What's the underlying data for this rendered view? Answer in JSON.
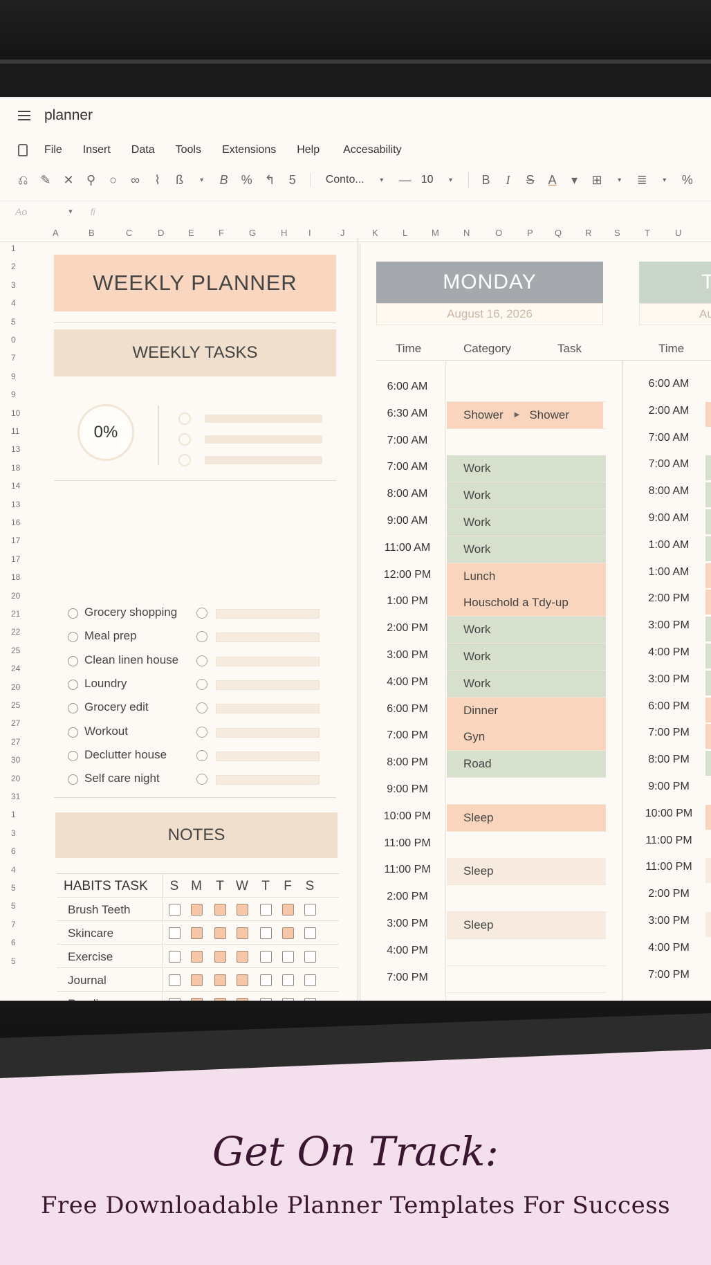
{
  "app": {
    "doc_title": "planner",
    "menu": [
      "File",
      "Insert",
      "Data",
      "Tools",
      "Extensions",
      "Help",
      "Accesability"
    ],
    "toolbar": {
      "icons": [
        "undo-icon",
        "paint-format-icon",
        "clear-icon",
        "highlight-icon",
        "search-icon",
        "zoom-icon",
        "link-icon",
        "bold-b-icon"
      ],
      "bold": "B",
      "percent": "%",
      "currency": "5",
      "font": "Conto...",
      "minus": "—",
      "size": "10",
      "bold2": "B",
      "italic": "I",
      "strike": "S",
      "text_color": "A"
    },
    "formula": {
      "cell_ref": "Ao",
      "fx": "fi"
    },
    "columns": [
      "A",
      "B",
      "C",
      "D",
      "E",
      "F",
      "G",
      "H",
      "I",
      "J",
      "K",
      "L",
      "M",
      "N",
      "O",
      "P",
      "Q",
      "R",
      "S",
      "T",
      "U"
    ],
    "rows": [
      "1",
      "2",
      "3",
      "4",
      "5",
      "0",
      "7",
      "9",
      "9",
      "10",
      "11",
      "13",
      "18",
      "14",
      "13",
      "16",
      "17",
      "17",
      "18",
      "20",
      "21",
      "22",
      "25",
      "24",
      "20",
      "25",
      "27",
      "27",
      "30",
      "20",
      "31",
      "1",
      "3",
      "6",
      "4",
      "5",
      "5",
      "7",
      "6",
      "5"
    ]
  },
  "planner": {
    "title": "WEEKLY PLANNER",
    "weekly_tasks": {
      "title": "WEEKLY TASKS",
      "progress": "0%",
      "tasks": [
        "Grocery shopping",
        "Meal prep",
        "Clean linen house",
        "Loundry",
        "Grocery edit",
        "Workout",
        "Declutter house",
        "Self care night"
      ]
    },
    "notes_title": "NOTES",
    "habits": {
      "title": "HABITS TASK",
      "days": [
        "S",
        "M",
        "T",
        "W",
        "T",
        "F",
        "S"
      ],
      "rows": [
        {
          "name": "Brush Teeth",
          "checks": [
            false,
            true,
            true,
            true,
            false,
            true,
            false
          ]
        },
        {
          "name": "Skincare",
          "checks": [
            false,
            true,
            true,
            true,
            false,
            true,
            false
          ]
        },
        {
          "name": "Exercise",
          "checks": [
            false,
            true,
            true,
            true,
            false,
            false,
            false
          ]
        },
        {
          "name": "Journal",
          "checks": [
            false,
            true,
            true,
            true,
            false,
            false,
            false
          ]
        },
        {
          "name": "Reading",
          "checks": [
            false,
            true,
            true,
            true,
            false,
            false,
            false
          ]
        },
        {
          "name": "Tidy Up",
          "checks": [
            false,
            false,
            false,
            false,
            false,
            false,
            false
          ]
        },
        {
          "name": "Self Care Night",
          "checks": [
            false,
            false,
            false,
            false,
            false,
            false,
            false
          ]
        }
      ]
    }
  },
  "schedule": {
    "monday": {
      "day": "MONDAY",
      "date": "August 16, 2026",
      "headers": [
        "Time",
        "Category",
        "Task"
      ],
      "rows": [
        {
          "time": "6:00 AM",
          "task": "",
          "color": "none"
        },
        {
          "time": "6:30 AM",
          "task": "Shower",
          "task2": "Shower",
          "color": "peach"
        },
        {
          "time": "7:00 AM",
          "task": "",
          "color": "none"
        },
        {
          "time": "7:00 AM",
          "task": "Work",
          "color": "green"
        },
        {
          "time": "8:00 AM",
          "task": "Work",
          "color": "green"
        },
        {
          "time": "9:00 AM",
          "task": "Work",
          "color": "green"
        },
        {
          "time": "11:00 AM",
          "task": "Work",
          "color": "green"
        },
        {
          "time": "12:00 PM",
          "task": "Lunch",
          "color": "peach"
        },
        {
          "time": "1:00 PM",
          "task": "Houschold a Tdy-up",
          "color": "peach"
        },
        {
          "time": "2:00 PM",
          "task": "Work",
          "color": "green"
        },
        {
          "time": "3:00 PM",
          "task": "Work",
          "color": "green"
        },
        {
          "time": "4:00 PM",
          "task": "Work",
          "color": "green"
        },
        {
          "time": "6:00 PM",
          "task": "Dinner",
          "color": "peach"
        },
        {
          "time": "7:00 PM",
          "task": "Gyn",
          "color": "peach"
        },
        {
          "time": "8:00 PM",
          "task": "Road",
          "color": "green"
        },
        {
          "time": "9:00 PM",
          "task": "",
          "color": "none"
        },
        {
          "time": "10:00 PM",
          "task": "Sleep",
          "color": "peach"
        },
        {
          "time": "11:00 PM",
          "task": "",
          "color": "none"
        },
        {
          "time": "11:00 PM",
          "task": "Sleep",
          "color": "light"
        },
        {
          "time": "2:00 PM",
          "task": "",
          "color": "none"
        },
        {
          "time": "3:00 PM",
          "task": "Sleep",
          "color": "light"
        },
        {
          "time": "4:00 PM",
          "task": "",
          "color": "none"
        },
        {
          "time": "7:00 PM",
          "task": "",
          "color": "none"
        }
      ]
    },
    "tuesday": {
      "day": "T",
      "date": "Au",
      "headers": [
        "Time"
      ],
      "times": [
        "6:00 AM",
        "2:00 AM",
        "7:00 AM",
        "7:00 AM",
        "8:00 AM",
        "9:00 AM",
        "1:00 AM",
        "1:00 AM",
        "2:00 PM",
        "3:00 PM",
        "4:00 PM",
        "3:00 PM",
        "6:00 PM",
        "7:00 PM",
        "8:00 PM",
        "9:00 PM",
        "10:00 PM",
        "11:00 PM",
        "11:00 PM",
        "2:00 PM",
        "3:00 PM",
        "4:00 PM",
        "7:00 PM"
      ]
    },
    "colors": {
      "peach": "#f9d5be",
      "green": "#d6e0cc",
      "light": "#f6ebde",
      "monday_banner": "#a5a8ad",
      "tuesday_banner": "#c9d6c9"
    }
  },
  "promo": {
    "title": "Get On Track:",
    "subtitle": "Free Downloadable Planner Templates For Success"
  }
}
